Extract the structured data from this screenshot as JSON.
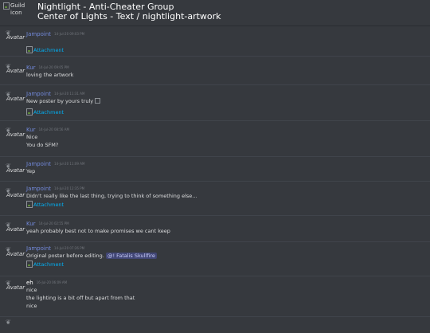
{
  "header": {
    "guild_icon_alt": "Guild icon",
    "guild_name": "Nightlight - Anti-Cheater Group",
    "channel_path": "Center of Lights - Text / nightlight-artwork"
  },
  "avatar_alt": "Avatar",
  "messages": [
    {
      "author": "Jampoint",
      "timestamp": "14-Jul-20 09:03 PM",
      "lines": [],
      "attachment": "Attachment"
    },
    {
      "author": "Kur",
      "timestamp": "14-Jul-20 09:05 PM",
      "lines": [
        "loving the artwork"
      ]
    },
    {
      "author": "Jampoint",
      "timestamp": "14-Jul-20 11:31 AM",
      "lines": [
        "New poster by yours truly"
      ],
      "attachment": "Attachment"
    },
    {
      "author": "Kur",
      "timestamp": "14-Jul-20 08:56 AM",
      "lines": [
        "Nice",
        "You do SFM?"
      ]
    },
    {
      "author": "Jampoint",
      "timestamp": "14-Jul-20 11:09 AM",
      "lines": [
        "Yep"
      ]
    },
    {
      "author": "Jampoint",
      "timestamp": "14-Jul-20 12:35 PM",
      "lines": [
        "Didn't really like the last thing, trying to think of something else..."
      ],
      "attachment": "Attachment"
    },
    {
      "author": "Kur",
      "timestamp": "14-Jul-20 02:55 PM",
      "lines": [
        "yeah probably best not to make promises we cant keep"
      ]
    },
    {
      "author": "Jampoint",
      "timestamp": "14-Jul-20 07:26 PM",
      "lines": [
        "Original poster before editing."
      ],
      "mention": "@! Fatalis Skullfire",
      "attachment": "Attachment"
    },
    {
      "author": "eh",
      "timestamp": "16-Jul-20 06:09 AM",
      "lines": [
        "nice",
        "the lighting is a bit off but apart from that",
        "nice"
      ]
    }
  ],
  "colors": {
    "background": "#36393e",
    "author_link": "#7289da",
    "attachment_link": "#00b0f4",
    "mention_bg": "#414675"
  }
}
